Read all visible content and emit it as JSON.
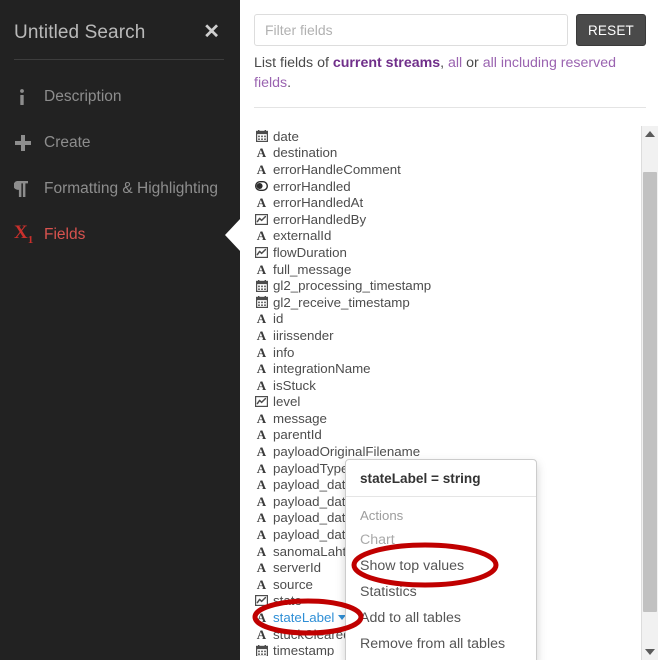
{
  "sidebar": {
    "title": "Untitled Search",
    "close_icon": "close-icon",
    "items": [
      {
        "icon": "info-icon",
        "glyph": "i",
        "label": "Description",
        "active": false
      },
      {
        "icon": "plus-icon",
        "glyph": "+",
        "label": "Create",
        "active": false
      },
      {
        "icon": "paragraph-icon",
        "glyph": "¶",
        "label": "Formatting & Highlighting",
        "active": false
      },
      {
        "icon": "variable-x1-icon",
        "glyph": "X1",
        "label": "Fields",
        "active": true
      }
    ]
  },
  "search": {
    "placeholder": "Filter fields",
    "value": "",
    "reset_label": "RESET"
  },
  "hint": {
    "prefix": "List fields of ",
    "current_streams": "current streams",
    "mid": ", ",
    "all": "all",
    "or": " or ",
    "all_reserved": "all including reserved fields",
    "suffix": "."
  },
  "fields": [
    {
      "name": "date",
      "type": "date"
    },
    {
      "name": "destination",
      "type": "string"
    },
    {
      "name": "errorHandleComment",
      "type": "string"
    },
    {
      "name": "errorHandled",
      "type": "boolean"
    },
    {
      "name": "errorHandledAt",
      "type": "string"
    },
    {
      "name": "errorHandledBy",
      "type": "number"
    },
    {
      "name": "externalId",
      "type": "string"
    },
    {
      "name": "flowDuration",
      "type": "number"
    },
    {
      "name": "full_message",
      "type": "string"
    },
    {
      "name": "gl2_processing_timestamp",
      "type": "date"
    },
    {
      "name": "gl2_receive_timestamp",
      "type": "date"
    },
    {
      "name": "id",
      "type": "string"
    },
    {
      "name": "iirissender",
      "type": "string"
    },
    {
      "name": "info",
      "type": "string"
    },
    {
      "name": "integrationName",
      "type": "string"
    },
    {
      "name": "isStuck",
      "type": "string"
    },
    {
      "name": "level",
      "type": "number"
    },
    {
      "name": "message",
      "type": "string"
    },
    {
      "name": "parentId",
      "type": "string"
    },
    {
      "name": "payloadOriginalFilename",
      "type": "string"
    },
    {
      "name": "payloadType",
      "type": "string"
    },
    {
      "name": "payload_dat",
      "type": "string"
    },
    {
      "name": "payload_dat",
      "type": "string"
    },
    {
      "name": "payload_dat",
      "type": "string"
    },
    {
      "name": "payload_dat",
      "type": "string"
    },
    {
      "name": "sanomaLaht",
      "type": "string"
    },
    {
      "name": "serverId",
      "type": "string"
    },
    {
      "name": "source",
      "type": "string"
    },
    {
      "name": "state",
      "type": "number"
    },
    {
      "name": "stateLabel",
      "type": "string",
      "selected": true
    },
    {
      "name": "stuckCleared",
      "type": "string"
    },
    {
      "name": "timestamp",
      "type": "date"
    }
  ],
  "popup": {
    "title": "stateLabel = string",
    "section_label": "Actions",
    "items": [
      {
        "label": "Chart",
        "disabled": true
      },
      {
        "label": "Show top values",
        "disabled": false
      },
      {
        "label": "Statistics",
        "disabled": false
      },
      {
        "label": "Add to all tables",
        "disabled": false
      },
      {
        "label": "Remove from all tables",
        "disabled": false
      }
    ]
  },
  "scrollbar": {
    "up_icon": "caret-up-icon",
    "down_icon": "caret-down-icon"
  },
  "colors": {
    "sidebar_bg": "#222222",
    "accent_red": "#d9534f",
    "link_purple": "#9a63b0",
    "strong_purple": "#702f8a",
    "selected_blue": "#2f8fd6",
    "annotation_red": "#c00000"
  }
}
